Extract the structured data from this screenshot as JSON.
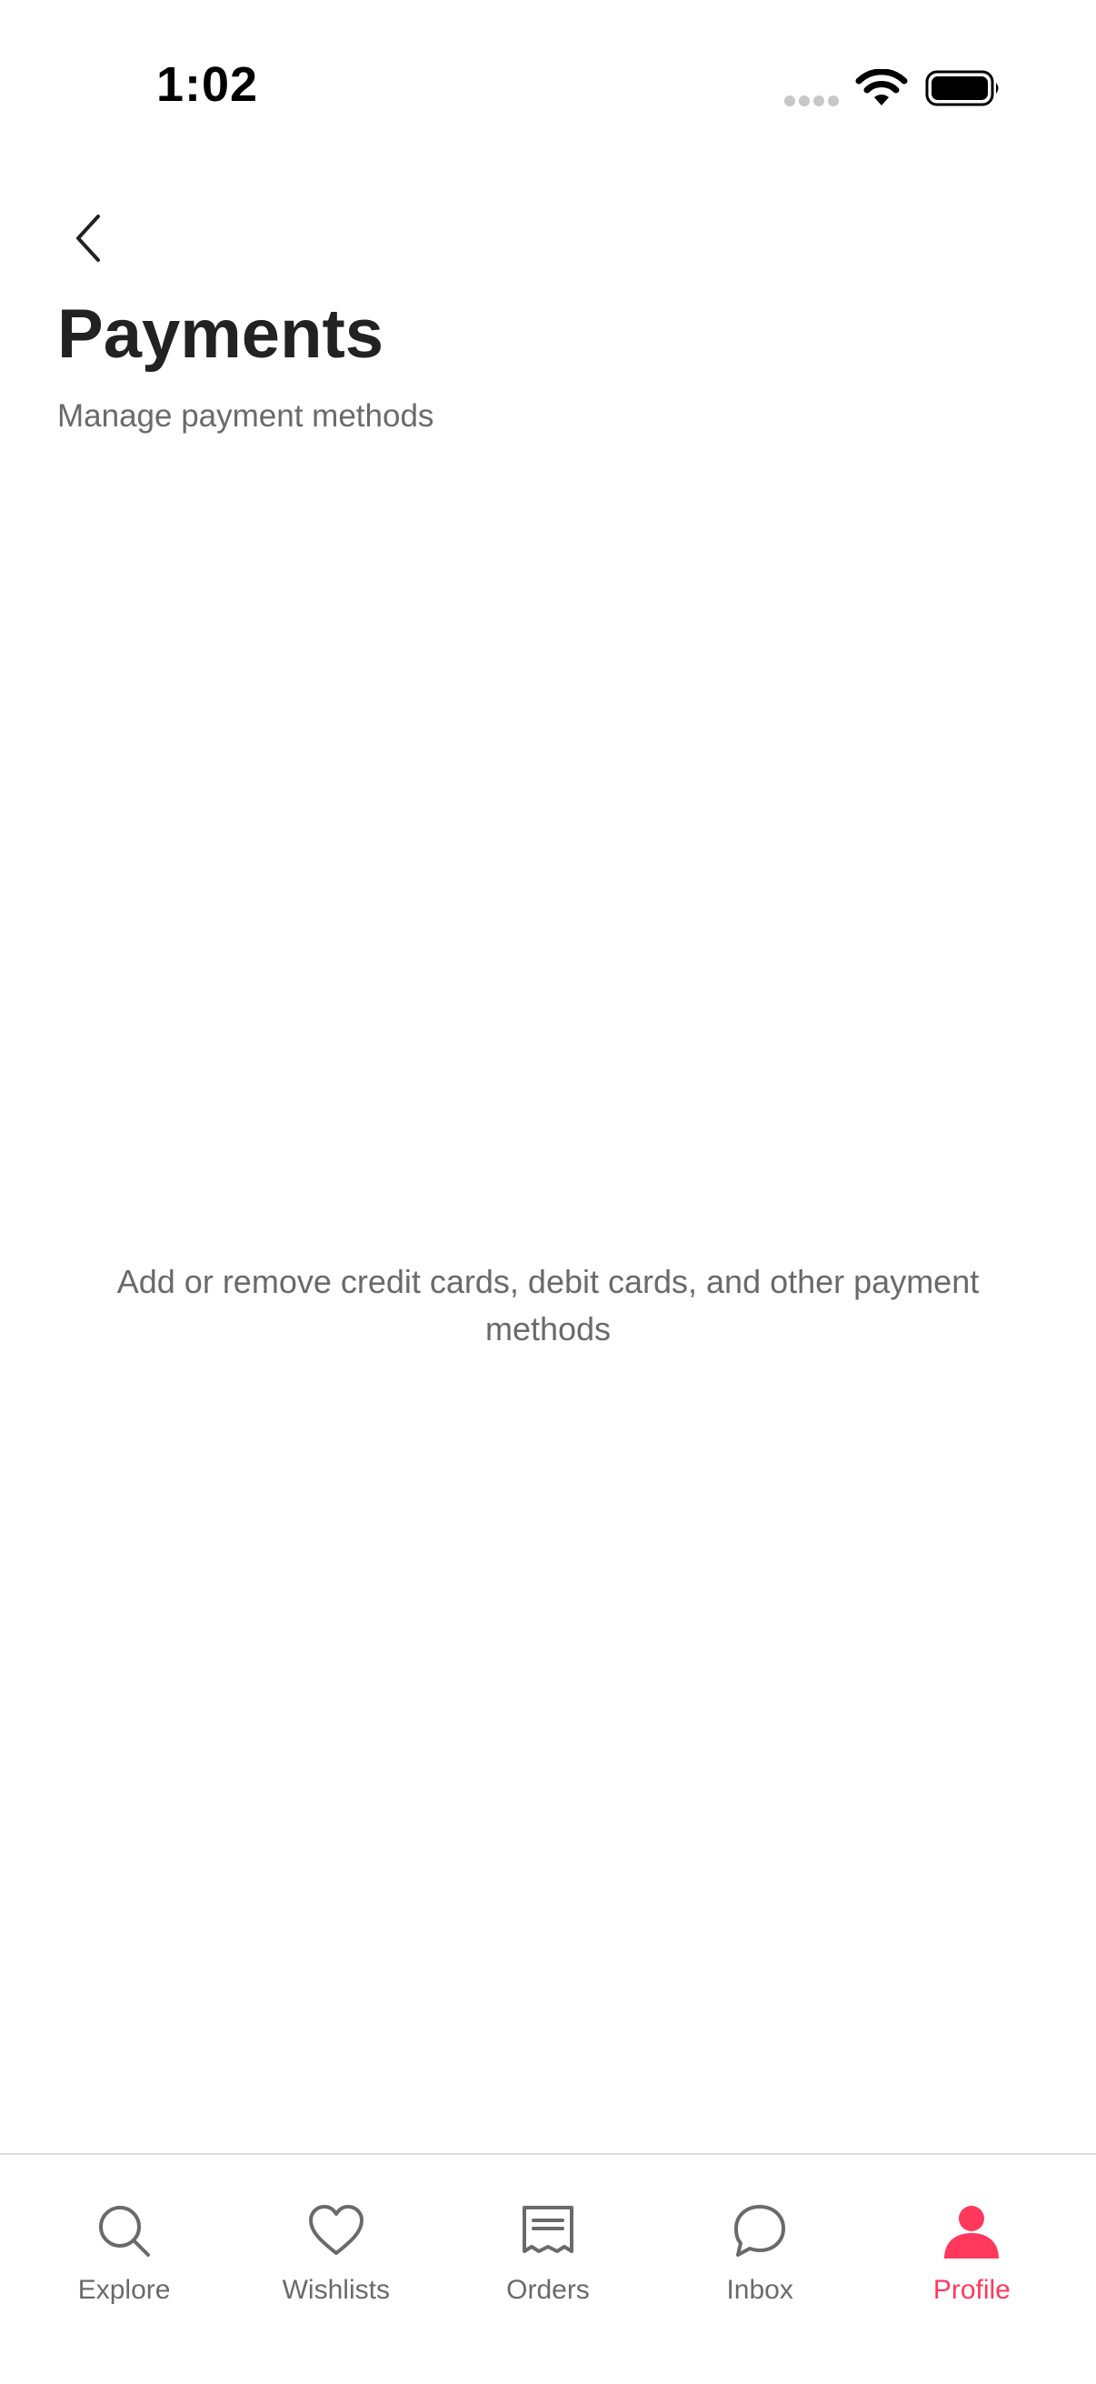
{
  "status_bar": {
    "time": "1:02"
  },
  "header": {
    "title": "Payments",
    "subtitle": "Manage payment methods"
  },
  "empty_state": {
    "message": "Add or remove credit cards, debit cards, and other payment methods"
  },
  "tab_bar": {
    "active_color": "#ff385c",
    "inactive_color": "#6a6a6a",
    "tabs": [
      {
        "label": "Explore",
        "icon": "search-icon",
        "active": false
      },
      {
        "label": "Wishlists",
        "icon": "heart-icon",
        "active": false
      },
      {
        "label": "Orders",
        "icon": "receipt-icon",
        "active": false
      },
      {
        "label": "Inbox",
        "icon": "chat-bubble-icon",
        "active": false
      },
      {
        "label": "Profile",
        "icon": "person-icon",
        "active": true
      }
    ]
  }
}
